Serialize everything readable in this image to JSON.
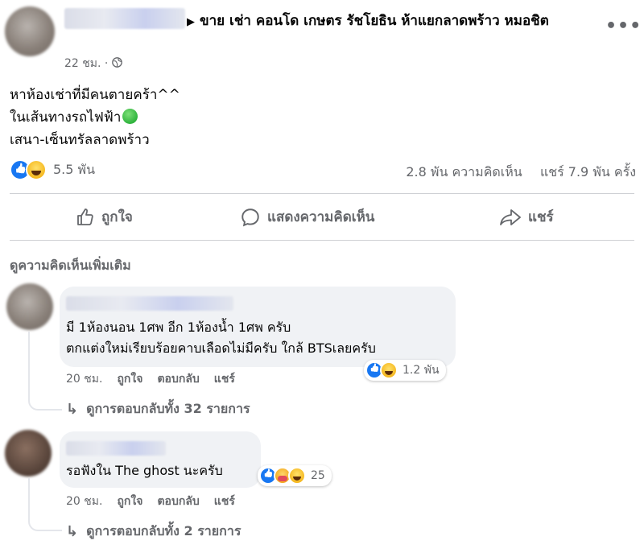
{
  "post": {
    "group_name": "ขาย เช่า คอนโด เกษตร รัชโยธิน ห้าแยกลาดพร้าว หมอชิต",
    "time": "22 ชม. ·",
    "body_line1": "หาห้องเช่าที่มีคนตายคร้า^^",
    "body_line2": "ในเส้นทางรถไฟฟ้า",
    "body_line3": "เสนา-เซ็นทรัลลาดพร้าว",
    "reaction_count": "5.5 พัน",
    "comments_count": "2.8 พัน ความคิดเห็น",
    "shares_count": "แชร์ 7.9 พัน ครั้ง"
  },
  "actions": {
    "like": "ถูกใจ",
    "comment": "แสดงความคิดเห็น",
    "share": "แชร์"
  },
  "more_comments": "ดูความคิดเห็นเพิ่มเติม",
  "comments": [
    {
      "line1": "มี 1ห้องนอน 1ศพ อีก 1ห้องน้ำ 1ศพ ครับ",
      "line2": "ตกแต่งใหม่เรียบร้อยคาบเลือดไม่มีครับ ใกล้ BTSเลยครับ",
      "time": "20 ชม.",
      "like": "ถูกใจ",
      "reply": "ตอบกลับ",
      "share": "แชร์",
      "reactions": "1.2 พัน",
      "view_replies": "ดูการตอบกลับทั้ง 32 รายการ"
    },
    {
      "line1": "รอฟังใน The ghost นะครับ",
      "time": "20 ชม.",
      "like": "ถูกใจ",
      "reply": "ตอบกลับ",
      "share": "แชร์",
      "reactions": "25",
      "view_replies": "ดูการตอบกลับทั้ง 2 รายการ"
    }
  ],
  "icons": [
    "globe-icon",
    "more-icon",
    "like-reaction-icon",
    "haha-reaction-icon",
    "care-reaction-icon",
    "green-circle-emoji",
    "like-outline-icon",
    "comment-outline-icon",
    "share-outline-icon",
    "reply-arrow-icon"
  ],
  "colors": {
    "accent": "#1877f2",
    "secondary_text": "#65676b",
    "bubble": "#f0f2f5"
  }
}
